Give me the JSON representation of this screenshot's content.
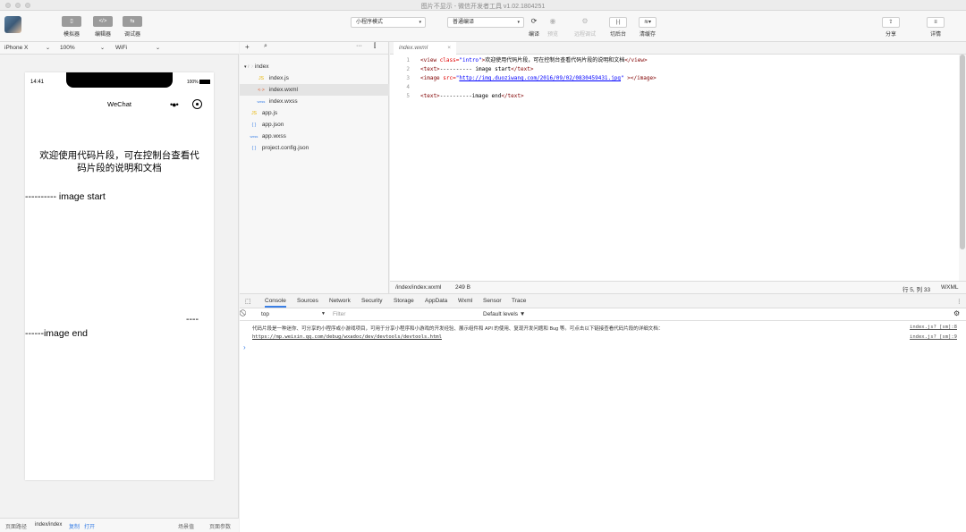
{
  "window": {
    "title": "图片不显示 - 微信开发者工具 v1.02.1804251"
  },
  "toolbar": {
    "simulator_label": "模拟器",
    "editor_label": "编辑器",
    "debugger_label": "调试器",
    "mode_select": "小程序模式",
    "compile_select": "普通编译",
    "compile_label": "编译",
    "preview_label": "预览",
    "remote_debug_label": "远程调试",
    "background_label": "切后台",
    "clear_cache_label": "清缓存",
    "share_label": "分享",
    "detail_label": "详情"
  },
  "device_bar": {
    "device": "iPhone X",
    "zoom": "100%",
    "network": "WiFi"
  },
  "phone": {
    "time": "14:41",
    "battery": "100%",
    "nav_title": "WeChat",
    "intro_text": "欢迎使用代码片段，可在控制台查看代码片段的说明和文档",
    "image_start": "---------- image start",
    "dashes": "----",
    "image_end": "------image end"
  },
  "path_bar": {
    "label": "页面路径",
    "path": "index/index",
    "copy": "复制",
    "open": "打开",
    "scene": "场景值",
    "params": "页面参数"
  },
  "file_tree": {
    "items": [
      {
        "name": "index",
        "icon": "▾ 🗁",
        "indent": 0
      },
      {
        "name": "index.js",
        "icon": "JS",
        "indent": 1
      },
      {
        "name": "index.wxml",
        "icon": "<·>",
        "indent": 1
      },
      {
        "name": "index.wxss",
        "icon": "wxss",
        "indent": 1
      },
      {
        "name": "app.js",
        "icon": "JS",
        "indent": 0
      },
      {
        "name": "app.json",
        "icon": "{ }",
        "indent": 0
      },
      {
        "name": "app.wxss",
        "icon": "wxss",
        "indent": 0
      },
      {
        "name": "project.config.json",
        "icon": "{ }",
        "indent": 0
      }
    ]
  },
  "editor": {
    "tab_name": "index.wxml",
    "lines": [
      {
        "n": "1",
        "tag_open": "<view ",
        "attr": "class=",
        "val": "\"intro\"",
        "rest_tag": ">",
        "text": "欢迎使用代码片段，可在控制台查看代码片段的说明和文档",
        "tag_close": "</view>"
      },
      {
        "n": "2",
        "tag_open": "<text>",
        "text": "---------- image start",
        "tag_close": "</text>"
      },
      {
        "n": "3",
        "tag_open": "<image ",
        "attr": "src=",
        "q1": "\"",
        "link": "http://img.duoziwang.com/2016/09/02/0830459431.jpg",
        "q2": "\"",
        "tag_close": " ></image>"
      },
      {
        "n": "4"
      },
      {
        "n": "5",
        "tag_open": "<text>",
        "text": "----------image end",
        "tag_close": "</text>"
      }
    ],
    "status_path": "/index/index.wxml",
    "status_size": "249 B",
    "status_pos": "行 5, 列 33",
    "status_lang": "WXML"
  },
  "console": {
    "tabs": [
      "Console",
      "Sources",
      "Network",
      "Security",
      "Storage",
      "AppData",
      "Wxml",
      "Sensor",
      "Trace"
    ],
    "context": "top",
    "filter_placeholder": "Filter",
    "levels": "Default levels ▼",
    "msg1": "代码片段是一种迷你、可分享的小程序或小游戏项目，可用于分享小程序和小游戏的开发经验、展示组件和 API 的使用、复现开发问题和 Bug 等。可点击以下链接查看代码片段的详细文档：",
    "msg1_src": "index.js? [sm]:8",
    "msg2": "https://mp.weixin.qq.com/debug/wxadoc/dev/devtools/devtools.html",
    "msg2_src": "index.js? [sm]:9",
    "prompt": "›"
  }
}
